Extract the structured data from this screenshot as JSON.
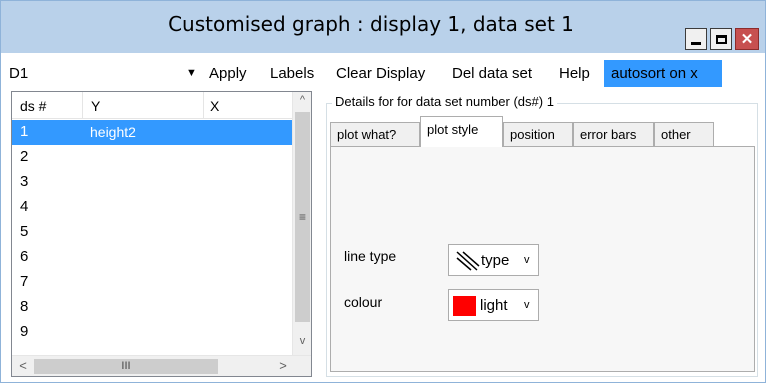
{
  "window": {
    "title": "Customised graph : display 1, data set 1",
    "close_glyph": "✕"
  },
  "toolbar": {
    "display_select_value": "D1",
    "display_select_arrow": "▼",
    "apply": "Apply",
    "labels": "Labels",
    "clear_display": "Clear Display",
    "del_data_set": "Del data set",
    "help": "Help",
    "autosort": "autosort on x"
  },
  "list": {
    "columns": [
      "ds #",
      "Y",
      "X"
    ],
    "rows": [
      {
        "num": "1",
        "y": "height2",
        "selected": true
      },
      {
        "num": "2",
        "y": ""
      },
      {
        "num": "3",
        "y": ""
      },
      {
        "num": "4",
        "y": ""
      },
      {
        "num": "5",
        "y": ""
      },
      {
        "num": "6",
        "y": ""
      },
      {
        "num": "7",
        "y": ""
      },
      {
        "num": "8",
        "y": ""
      },
      {
        "num": "9",
        "y": ""
      }
    ],
    "scroll_up": "^",
    "scroll_down": "v",
    "scroll_left": "<",
    "scroll_right": ">",
    "thumb_grip_v": "≡",
    "thumb_grip_h": "III"
  },
  "details": {
    "group_label": "Details for for data set number (ds#) 1",
    "tabs": [
      "plot what?",
      "plot style",
      "position",
      "error bars",
      "other"
    ],
    "active_tab": "plot style",
    "line_type_label": "line type",
    "line_type_value": "type",
    "colour_label": "colour",
    "colour_value": "light",
    "colour_hex": "#ff0000",
    "combo_arrow": "v"
  },
  "colors": {
    "titlebar": "#b9d1ea",
    "selection": "#3399ff",
    "close_button": "#c75050"
  }
}
